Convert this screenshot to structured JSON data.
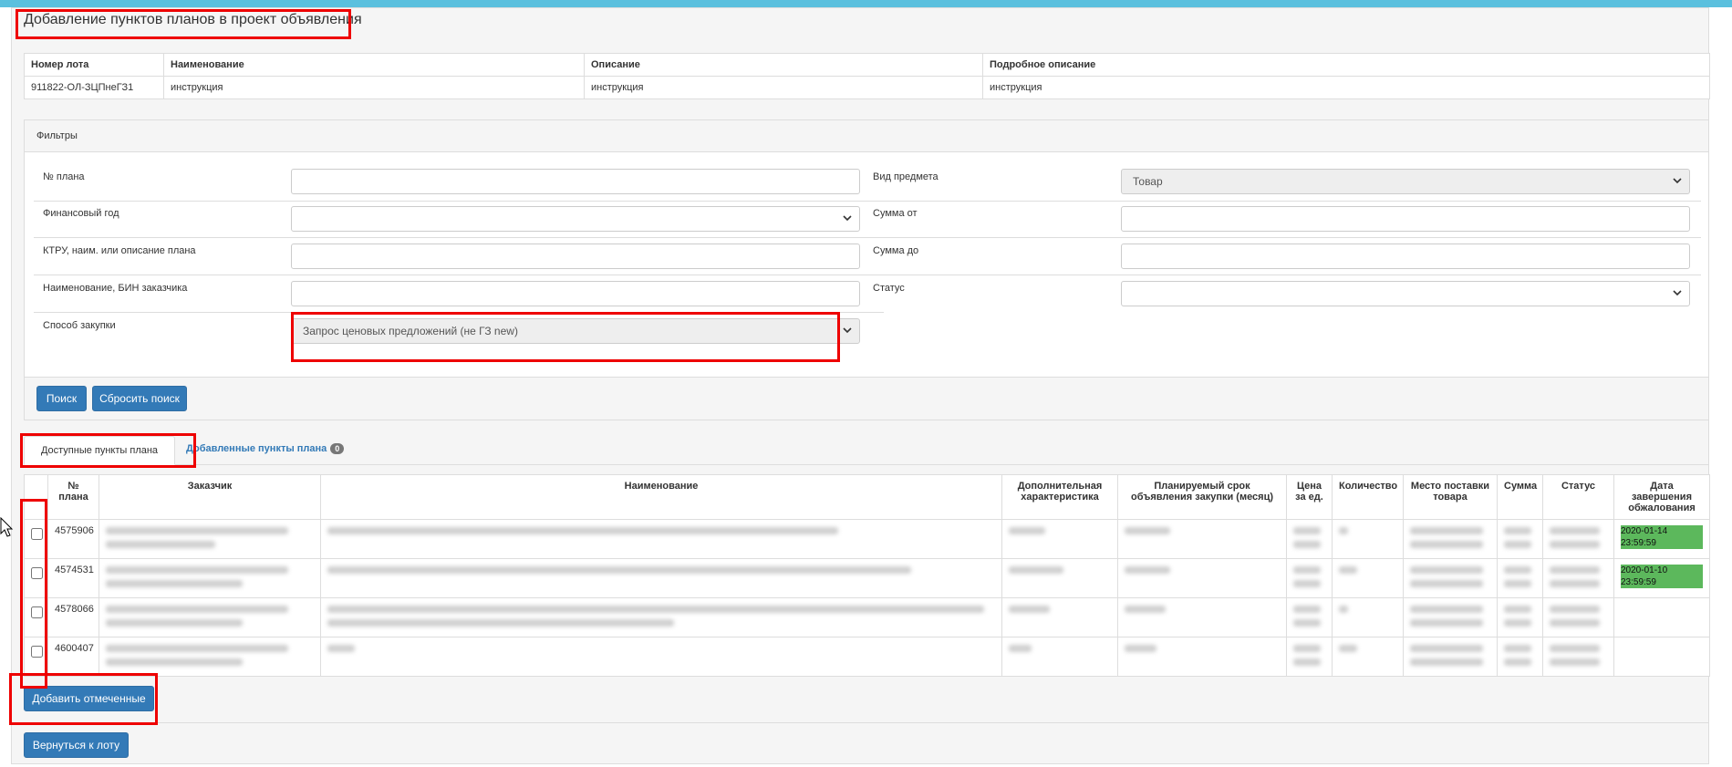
{
  "page_title": "Добавление пунктов планов в проект объявления",
  "lot_table": {
    "headers": [
      "Номер лота",
      "Наименование",
      "Описание",
      "Подробное описание"
    ],
    "row": [
      "911822-ОЛ-ЗЦПнеГЗ1",
      "инструкция",
      "инструкция",
      "инструкция"
    ]
  },
  "filters": {
    "title": "Фильтры",
    "plan_no_label": "№ плана",
    "fin_year_label": "Финансовый год",
    "ktru_label": "КТРУ, наим. или описание плана",
    "customer_label": "Наименование, БИН заказчика",
    "method_label": "Способ закупки",
    "method_value": "Запрос ценовых предложений (не ГЗ new)",
    "subject_type_label": "Вид предмета",
    "subject_type_value": "Товар",
    "sum_from_label": "Сумма от",
    "sum_to_label": "Сумма до",
    "status_label": "Статус",
    "search_button": "Поиск",
    "reset_button": "Сбросить поиск"
  },
  "tabs": {
    "available": "Доступные пункты плана",
    "added": "Добавленные пункты плана",
    "added_count": "0"
  },
  "items_table": {
    "headers": [
      "№ плана",
      "Заказчик",
      "Наименование",
      "Дополнительная характеристика",
      "Планируемый срок объявления закупки (месяц)",
      "Цена за ед.",
      "Количество",
      "Место поставки товара",
      "Сумма",
      "Статус",
      "Дата завершения обжалования"
    ],
    "rows": [
      {
        "plan_no": "4575906",
        "date": "2020-01-14 23:59:59"
      },
      {
        "plan_no": "4574531",
        "date": "2020-01-10 23:59:59"
      },
      {
        "plan_no": "4578066",
        "date": ""
      },
      {
        "plan_no": "4600407",
        "date": ""
      }
    ]
  },
  "add_checked_button": "Добавить отмеченные",
  "back_button": "Вернуться к лоту",
  "colors": {
    "accent": "#337ab7",
    "topbar": "#5bc0de",
    "highlight": "#e00000",
    "date_bg": "#5cb85c"
  }
}
